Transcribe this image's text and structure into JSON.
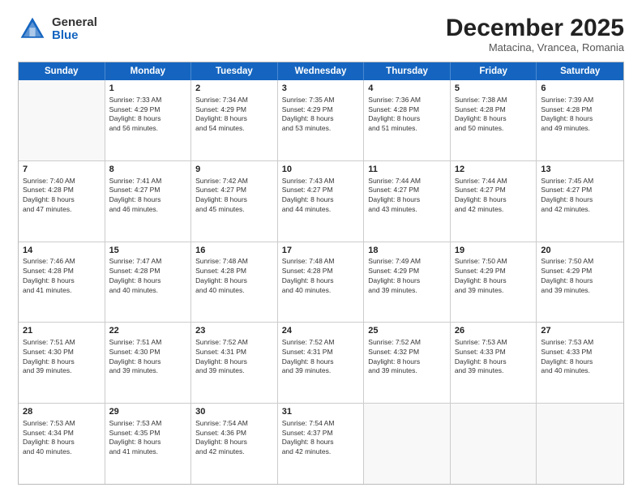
{
  "header": {
    "logo_general": "General",
    "logo_blue": "Blue",
    "month_title": "December 2025",
    "subtitle": "Matacina, Vrancea, Romania"
  },
  "weekdays": [
    "Sunday",
    "Monday",
    "Tuesday",
    "Wednesday",
    "Thursday",
    "Friday",
    "Saturday"
  ],
  "weeks": [
    [
      {
        "day": "",
        "info": ""
      },
      {
        "day": "1",
        "info": "Sunrise: 7:33 AM\nSunset: 4:29 PM\nDaylight: 8 hours\nand 56 minutes."
      },
      {
        "day": "2",
        "info": "Sunrise: 7:34 AM\nSunset: 4:29 PM\nDaylight: 8 hours\nand 54 minutes."
      },
      {
        "day": "3",
        "info": "Sunrise: 7:35 AM\nSunset: 4:29 PM\nDaylight: 8 hours\nand 53 minutes."
      },
      {
        "day": "4",
        "info": "Sunrise: 7:36 AM\nSunset: 4:28 PM\nDaylight: 8 hours\nand 51 minutes."
      },
      {
        "day": "5",
        "info": "Sunrise: 7:38 AM\nSunset: 4:28 PM\nDaylight: 8 hours\nand 50 minutes."
      },
      {
        "day": "6",
        "info": "Sunrise: 7:39 AM\nSunset: 4:28 PM\nDaylight: 8 hours\nand 49 minutes."
      }
    ],
    [
      {
        "day": "7",
        "info": "Sunrise: 7:40 AM\nSunset: 4:28 PM\nDaylight: 8 hours\nand 47 minutes."
      },
      {
        "day": "8",
        "info": "Sunrise: 7:41 AM\nSunset: 4:27 PM\nDaylight: 8 hours\nand 46 minutes."
      },
      {
        "day": "9",
        "info": "Sunrise: 7:42 AM\nSunset: 4:27 PM\nDaylight: 8 hours\nand 45 minutes."
      },
      {
        "day": "10",
        "info": "Sunrise: 7:43 AM\nSunset: 4:27 PM\nDaylight: 8 hours\nand 44 minutes."
      },
      {
        "day": "11",
        "info": "Sunrise: 7:44 AM\nSunset: 4:27 PM\nDaylight: 8 hours\nand 43 minutes."
      },
      {
        "day": "12",
        "info": "Sunrise: 7:44 AM\nSunset: 4:27 PM\nDaylight: 8 hours\nand 42 minutes."
      },
      {
        "day": "13",
        "info": "Sunrise: 7:45 AM\nSunset: 4:27 PM\nDaylight: 8 hours\nand 42 minutes."
      }
    ],
    [
      {
        "day": "14",
        "info": "Sunrise: 7:46 AM\nSunset: 4:28 PM\nDaylight: 8 hours\nand 41 minutes."
      },
      {
        "day": "15",
        "info": "Sunrise: 7:47 AM\nSunset: 4:28 PM\nDaylight: 8 hours\nand 40 minutes."
      },
      {
        "day": "16",
        "info": "Sunrise: 7:48 AM\nSunset: 4:28 PM\nDaylight: 8 hours\nand 40 minutes."
      },
      {
        "day": "17",
        "info": "Sunrise: 7:48 AM\nSunset: 4:28 PM\nDaylight: 8 hours\nand 40 minutes."
      },
      {
        "day": "18",
        "info": "Sunrise: 7:49 AM\nSunset: 4:29 PM\nDaylight: 8 hours\nand 39 minutes."
      },
      {
        "day": "19",
        "info": "Sunrise: 7:50 AM\nSunset: 4:29 PM\nDaylight: 8 hours\nand 39 minutes."
      },
      {
        "day": "20",
        "info": "Sunrise: 7:50 AM\nSunset: 4:29 PM\nDaylight: 8 hours\nand 39 minutes."
      }
    ],
    [
      {
        "day": "21",
        "info": "Sunrise: 7:51 AM\nSunset: 4:30 PM\nDaylight: 8 hours\nand 39 minutes."
      },
      {
        "day": "22",
        "info": "Sunrise: 7:51 AM\nSunset: 4:30 PM\nDaylight: 8 hours\nand 39 minutes."
      },
      {
        "day": "23",
        "info": "Sunrise: 7:52 AM\nSunset: 4:31 PM\nDaylight: 8 hours\nand 39 minutes."
      },
      {
        "day": "24",
        "info": "Sunrise: 7:52 AM\nSunset: 4:31 PM\nDaylight: 8 hours\nand 39 minutes."
      },
      {
        "day": "25",
        "info": "Sunrise: 7:52 AM\nSunset: 4:32 PM\nDaylight: 8 hours\nand 39 minutes."
      },
      {
        "day": "26",
        "info": "Sunrise: 7:53 AM\nSunset: 4:33 PM\nDaylight: 8 hours\nand 39 minutes."
      },
      {
        "day": "27",
        "info": "Sunrise: 7:53 AM\nSunset: 4:33 PM\nDaylight: 8 hours\nand 40 minutes."
      }
    ],
    [
      {
        "day": "28",
        "info": "Sunrise: 7:53 AM\nSunset: 4:34 PM\nDaylight: 8 hours\nand 40 minutes."
      },
      {
        "day": "29",
        "info": "Sunrise: 7:53 AM\nSunset: 4:35 PM\nDaylight: 8 hours\nand 41 minutes."
      },
      {
        "day": "30",
        "info": "Sunrise: 7:54 AM\nSunset: 4:36 PM\nDaylight: 8 hours\nand 42 minutes."
      },
      {
        "day": "31",
        "info": "Sunrise: 7:54 AM\nSunset: 4:37 PM\nDaylight: 8 hours\nand 42 minutes."
      },
      {
        "day": "",
        "info": ""
      },
      {
        "day": "",
        "info": ""
      },
      {
        "day": "",
        "info": ""
      }
    ]
  ]
}
